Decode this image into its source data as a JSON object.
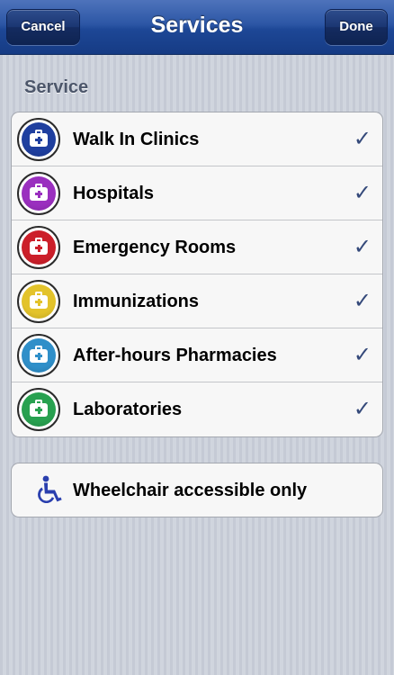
{
  "navbar": {
    "title": "Services",
    "cancel_label": "Cancel",
    "done_label": "Done"
  },
  "section": {
    "header": "Service"
  },
  "services": [
    {
      "label": "Walk In Clinics",
      "icon": "walk-in-clinic-medkit-icon",
      "color": "#1f3f9f",
      "checked": true
    },
    {
      "label": "Hospitals",
      "icon": "hospital-medkit-icon",
      "color": "#9a2fbf",
      "checked": true
    },
    {
      "label": "Emergency Rooms",
      "icon": "emergency-medkit-icon",
      "color": "#cc1f2a",
      "checked": true
    },
    {
      "label": "Immunizations",
      "icon": "immunization-medkit-icon",
      "color": "#e3c32b",
      "checked": true
    },
    {
      "label": "After-hours Pharmacies",
      "icon": "pharmacy-medkit-icon",
      "color": "#2f8fc9",
      "checked": true
    },
    {
      "label": "Laboratories",
      "icon": "laboratory-medkit-icon",
      "color": "#28a150",
      "checked": true
    }
  ],
  "check_glyph": "✓",
  "accessibility": {
    "label": "Wheelchair accessible only",
    "icon": "wheelchair-icon",
    "icon_color": "#2a3fae"
  }
}
